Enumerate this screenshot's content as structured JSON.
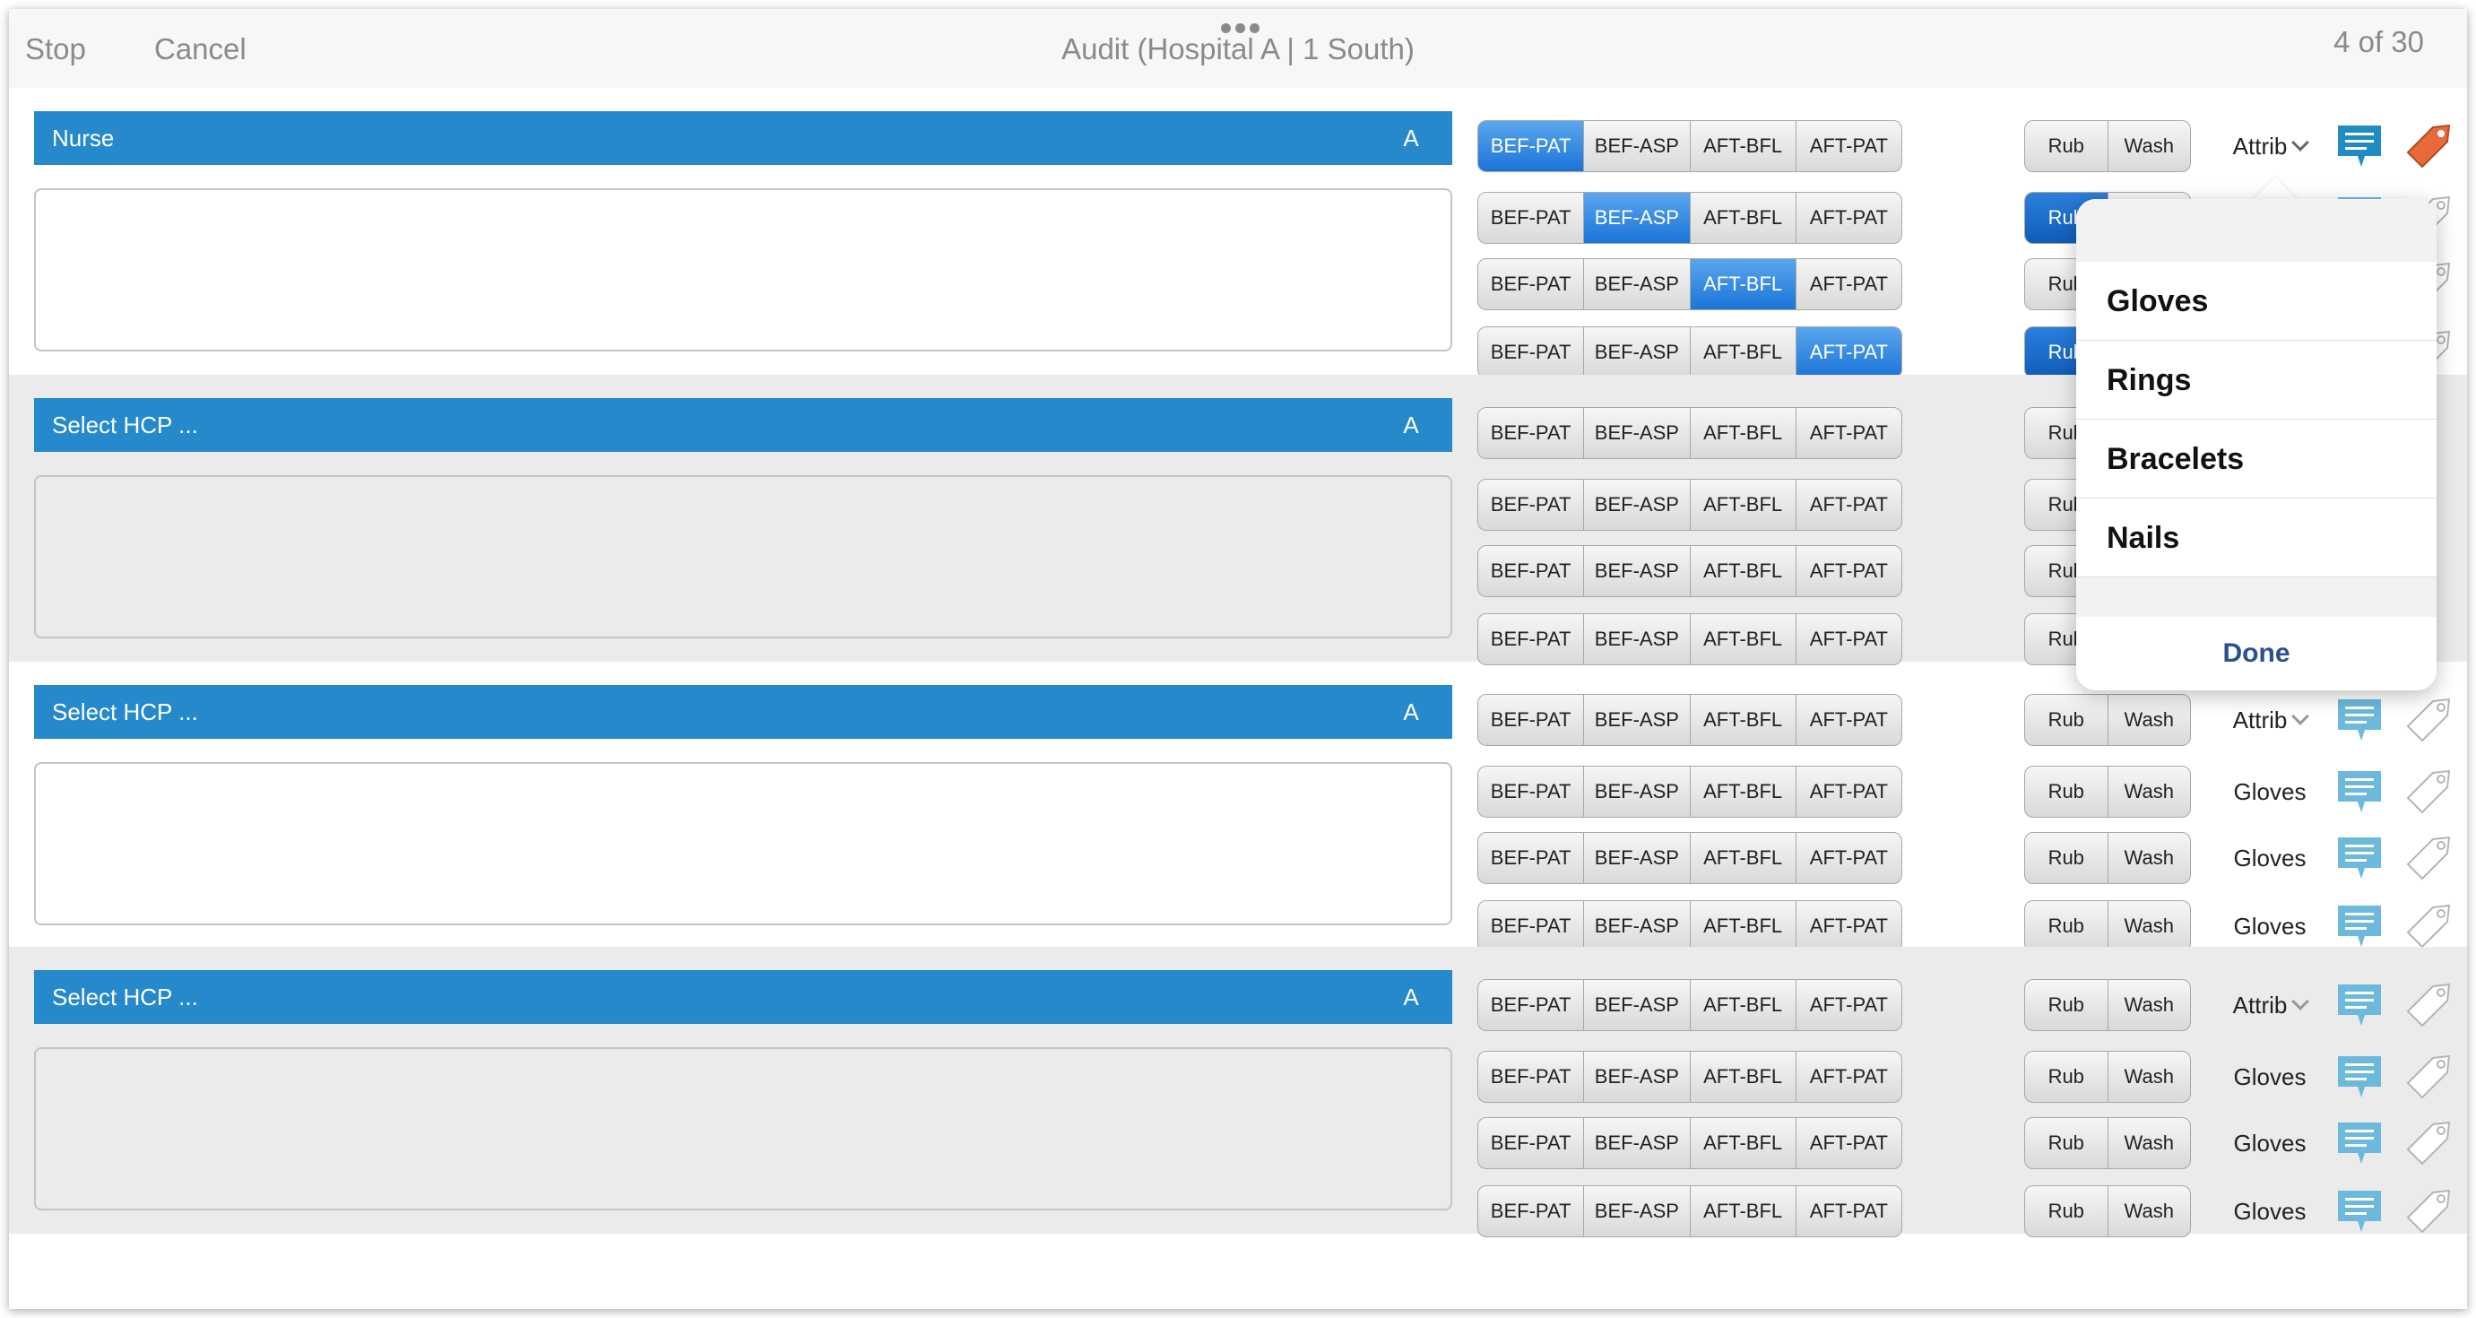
{
  "topbar": {
    "stop_label": "Stop",
    "cancel_label": "Cancel",
    "title": "Audit (Hospital A | 1 South)",
    "counter": "4 of 30"
  },
  "moments": [
    "BEF-PAT",
    "BEF-ASP",
    "AFT-BFL",
    "AFT-PAT"
  ],
  "method": [
    "Rub",
    "Wash"
  ],
  "groups": [
    {
      "hcp_label": "Nurse",
      "a_label": "A",
      "selected_moments": [
        0,
        1,
        2,
        3
      ],
      "attributes": [
        "Attrib",
        "",
        "",
        ""
      ]
    },
    {
      "hcp_label": "Select HCP ...",
      "a_label": "A",
      "attributes": [
        "",
        "",
        "",
        ""
      ]
    },
    {
      "hcp_label": "Select HCP ...",
      "a_label": "A",
      "attributes": [
        "Attrib",
        "Gloves",
        "Gloves",
        "Gloves"
      ]
    },
    {
      "hcp_label": "Select HCP ...",
      "a_label": "A",
      "attributes": [
        "Attrib",
        "Gloves",
        "Gloves",
        "Gloves"
      ]
    }
  ],
  "popover": {
    "items": [
      "Gloves",
      "Rings",
      "Bracelets",
      "Nails"
    ],
    "done_label": "Done"
  },
  "icons": {
    "chat": "chat-bubble-icon",
    "tag": "tag-icon",
    "chevron": "chevron-down-icon",
    "more": "more-dots-icon"
  },
  "colors": {
    "accent": "#2589cb",
    "selected": "#1b74d8",
    "chat_icon": "#6cb9dc",
    "tag_active": "#e86a3a"
  }
}
